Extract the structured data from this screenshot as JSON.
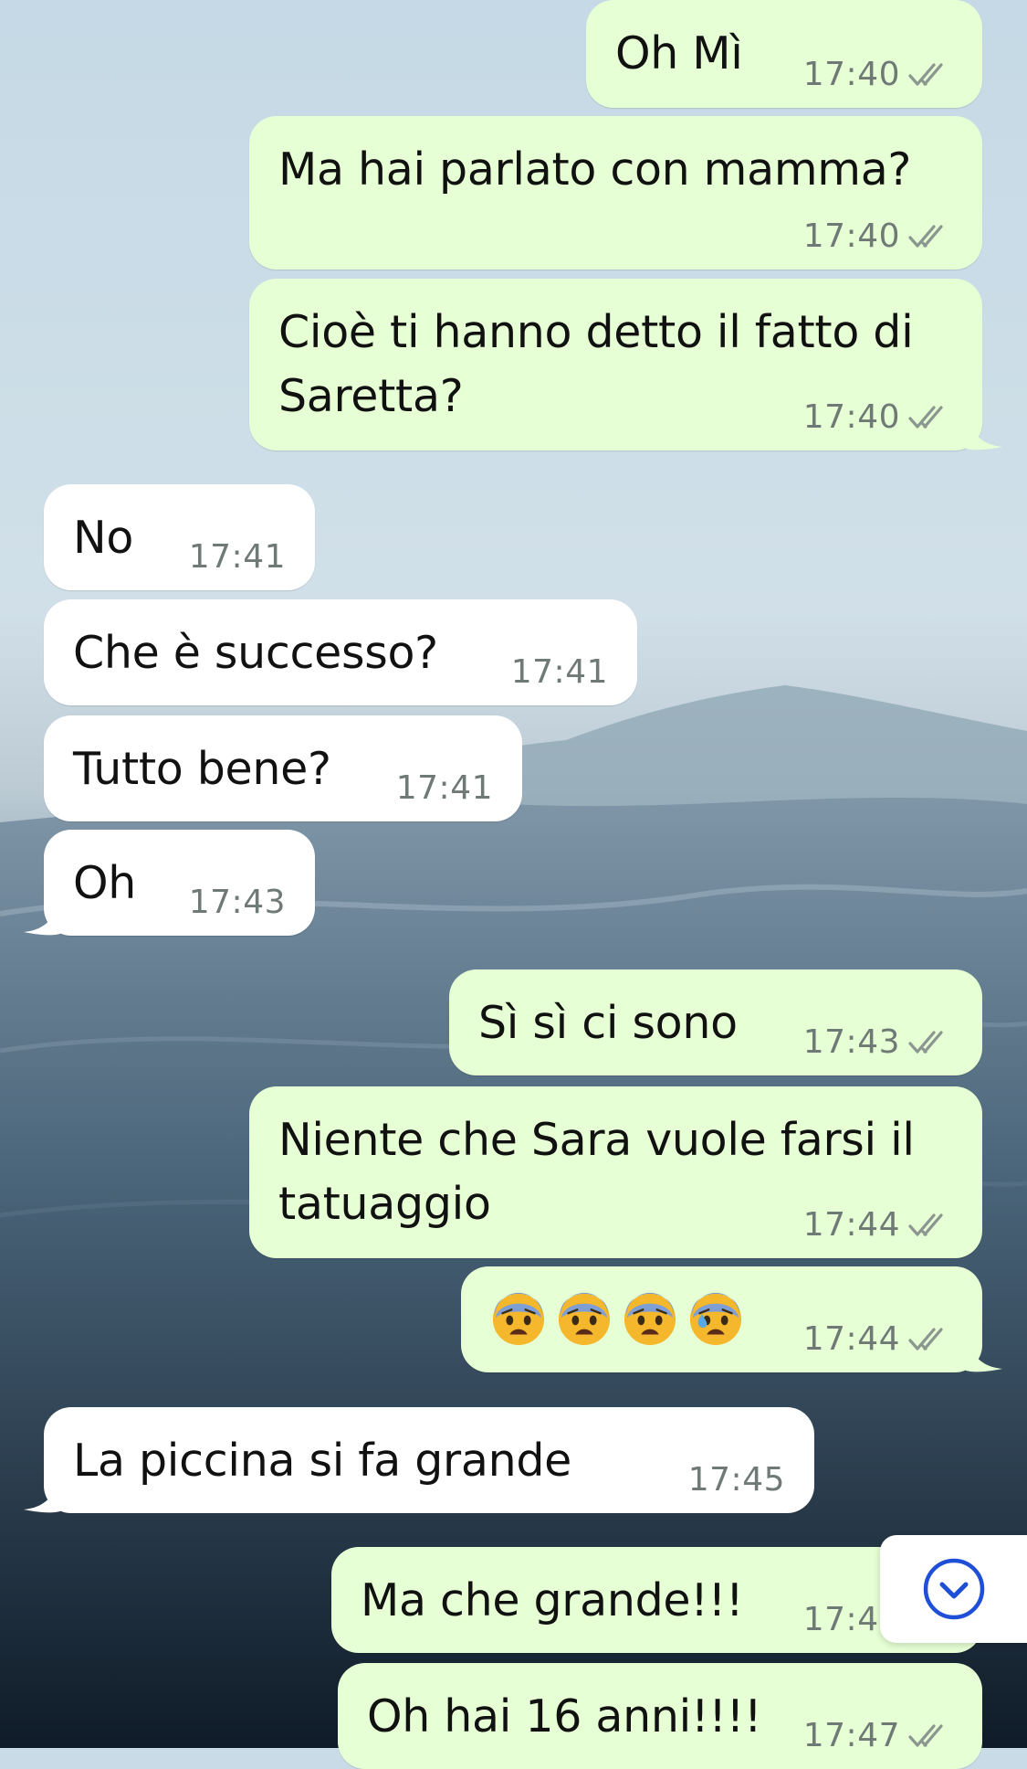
{
  "messages": [
    {
      "side": "out",
      "text": "Oh Mì",
      "time": "17:40"
    },
    {
      "side": "out",
      "text": "Ma hai parlato con mamma?",
      "time": "17:40"
    },
    {
      "side": "out",
      "text": "Cioè ti hanno detto il fatto di\nSaretta?",
      "time": "17:40"
    },
    {
      "side": "in",
      "text": "No",
      "time": "17:41"
    },
    {
      "side": "in",
      "text": "Che è successo?",
      "time": "17:41"
    },
    {
      "side": "in",
      "text": "Tutto bene?",
      "time": "17:41"
    },
    {
      "side": "in",
      "text": "Oh",
      "time": "17:43"
    },
    {
      "side": "out",
      "text": "Sì sì ci sono",
      "time": "17:43"
    },
    {
      "side": "out",
      "text": "Niente che Sara vuole farsi il\ntatuaggio",
      "time": "17:44"
    },
    {
      "side": "out",
      "emojis": [
        "fearful-face",
        "fearful-face",
        "fearful-face",
        "anxious-face-with-sweat"
      ],
      "time": "17:44"
    },
    {
      "side": "in",
      "text": "La piccina si fa grande",
      "time": "17:45"
    },
    {
      "side": "out",
      "text": "Ma che grande!!!",
      "time": "17:47"
    },
    {
      "side": "out",
      "text": "Oh hai 16 anni!!!!",
      "time": "17:47"
    }
  ],
  "read_receipt_icon": "double-check-icon",
  "scroll_button_icon": "chevron-down-circle-icon",
  "colors": {
    "outgoing": "#e6ffd4",
    "incoming": "#ffffff",
    "timestamp": "#6f7a76",
    "accent": "#1f4fd6"
  }
}
